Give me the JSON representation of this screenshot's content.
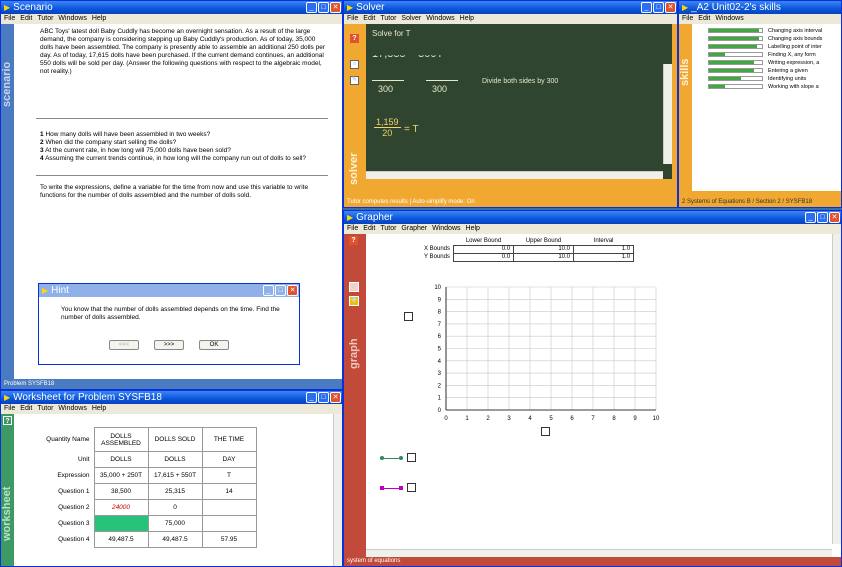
{
  "scenario": {
    "title": "Scenario",
    "menu": [
      "File",
      "Edit",
      "Tutor",
      "Windows",
      "Help"
    ],
    "sidebar_label": "scenario",
    "paragraph": "ABC Toys' latest doll Baby Cuddly has become an overnight sensation. As a result of the large demand, the company is considering stepping up Baby Cuddly's production. As of today, 35,000 dolls have been assembled. The company is presently able to assemble an additional 250 dolls per day. As of today, 17,615 dolls have been purchased. If the current demand continues, an additional 550 dolls will be sold per day. (Answer the following questions with respect to the algebraic model, not reality.)",
    "questions": [
      {
        "num": "1",
        "text": "How many dolls will have been assembled in two weeks?"
      },
      {
        "num": "2",
        "text": "When did the company start selling the dolls?"
      },
      {
        "num": "3",
        "text": "At the current rate, in how long will 75,000 dolls have been sold?"
      },
      {
        "num": "4",
        "text": "Assuming the current trends continue, in how long will the company run out of dolls to sell?"
      }
    ],
    "instructions": "To write the expressions, define a variable for the time from now and use this variable to write functions for the number of dolls assembled and the number of dolls sold.",
    "status": "Problem SYSFB18"
  },
  "hint": {
    "title": "Hint",
    "text": "You know that the number of dolls assembled depends on the time. Find the number of dolls assembled.",
    "prev_label": "<<<",
    "next_label": ">>>",
    "ok_label": "OK"
  },
  "worksheet": {
    "title": "Worksheet for Problem SYSFB18",
    "menu": [
      "File",
      "Edit",
      "Tutor",
      "Windows",
      "Help"
    ],
    "sidebar_label": "worksheet",
    "headers": [
      "Quantity Name",
      "DOLLS ASSEMBLED",
      "DOLLS SOLD",
      "THE TIME"
    ],
    "rows": [
      {
        "label": "Unit",
        "cells": [
          "DOLLS",
          "DOLLS",
          "DAY"
        ]
      },
      {
        "label": "Expression",
        "cells": [
          "35,000 + 250T",
          "17,615 + 550T",
          "T"
        ]
      },
      {
        "label": "Question 1",
        "cells": [
          "38,500",
          "25,315",
          "14"
        ]
      },
      {
        "label": "Question 2",
        "cells": [
          "24000",
          "0",
          ""
        ]
      },
      {
        "label": "Question 3",
        "cells": [
          "",
          "75,000",
          ""
        ]
      },
      {
        "label": "Question 4",
        "cells": [
          "49,487.5",
          "49,487.5",
          "57.95"
        ]
      }
    ]
  },
  "solver": {
    "title": "Solver",
    "menu": [
      "File",
      "Edit",
      "Tutor",
      "Solver",
      "Windows",
      "Help"
    ],
    "sidebar_label": "solver",
    "heading": "Solve for T",
    "top_partial": "17,385 = 300T",
    "denominators": [
      "300",
      "300"
    ],
    "step_text": "Divide both sides by 300",
    "result_num": "1,159",
    "result_den": "20",
    "result_var": "= T",
    "status": "Tutor computes results  |  Auto-simplify mode: On"
  },
  "skills": {
    "title": "_A2 Unit02-2's skills",
    "menu": [
      "File",
      "Edit",
      "Windows"
    ],
    "sidebar_label": "skills",
    "items": [
      {
        "label": "Changing axis interval",
        "level": 0.95
      },
      {
        "label": "Changing axis bounds",
        "level": 0.95
      },
      {
        "label": "Labelling point of inter",
        "level": 0.9
      },
      {
        "label": "Finding X, any form",
        "level": 0.3
      },
      {
        "label": "Writing expression, a",
        "level": 0.85
      },
      {
        "label": "Entering a given",
        "level": 0.85
      },
      {
        "label": "Identifying units",
        "level": 0.6
      },
      {
        "label": "Working with slope a",
        "level": 0.3
      }
    ],
    "status": "2  Systems of Equations B / Section 2 / SYSFB18"
  },
  "grapher": {
    "title": "Grapher",
    "menu": [
      "File",
      "Edit",
      "Tutor",
      "Grapher",
      "Windows",
      "Help"
    ],
    "sidebar_label": "graph",
    "bounds_headers": [
      "Lower Bound",
      "Upper Bound",
      "Interval"
    ],
    "x_bounds": {
      "label": "X Bounds",
      "lower": "0.0",
      "upper": "10.0",
      "interval": "1.0"
    },
    "y_bounds": {
      "label": "Y Bounds",
      "lower": "0.0",
      "upper": "10.0",
      "interval": "1.0"
    },
    "x_ticks": [
      "0",
      "1",
      "2",
      "3",
      "4",
      "5",
      "6",
      "7",
      "8",
      "9",
      "10"
    ],
    "y_ticks": [
      "10",
      "9",
      "8",
      "7",
      "6",
      "5",
      "4",
      "3",
      "2",
      "1",
      "0"
    ],
    "status": "system of equations",
    "colors": {
      "line1": "#2e8b57",
      "line2": "#c000c0"
    }
  }
}
